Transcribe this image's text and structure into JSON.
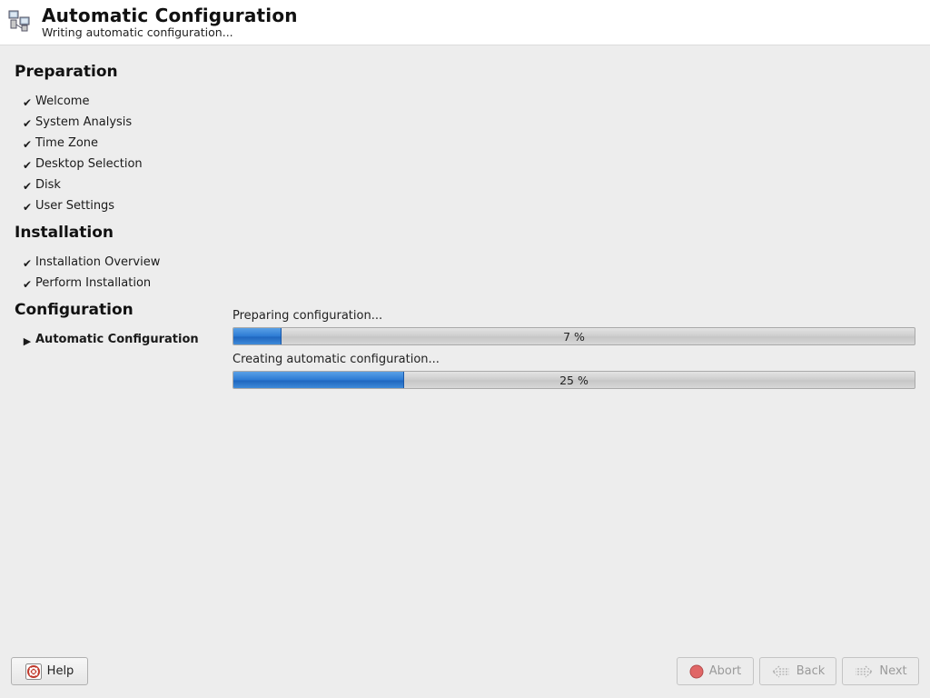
{
  "header": {
    "title": "Automatic Configuration",
    "subtitle": "Writing automatic configuration...",
    "icon": "network-config-icon"
  },
  "sidebar": {
    "sections": [
      {
        "title": "Preparation",
        "steps": [
          {
            "label": "Welcome",
            "status": "done"
          },
          {
            "label": "System Analysis",
            "status": "done"
          },
          {
            "label": "Time Zone",
            "status": "done"
          },
          {
            "label": "Desktop Selection",
            "status": "done"
          },
          {
            "label": "Disk",
            "status": "done"
          },
          {
            "label": "User Settings",
            "status": "done"
          }
        ]
      },
      {
        "title": "Installation",
        "steps": [
          {
            "label": "Installation Overview",
            "status": "done"
          },
          {
            "label": "Perform Installation",
            "status": "done"
          }
        ]
      },
      {
        "title": "Configuration",
        "steps": [
          {
            "label": "Automatic Configuration",
            "status": "current"
          }
        ]
      }
    ],
    "done_mark": "✔",
    "current_mark": "▶"
  },
  "progress": [
    {
      "label": "Preparing configuration...",
      "percent": 7,
      "text": "7 %"
    },
    {
      "label": "Creating automatic configuration...",
      "percent": 25,
      "text": "25 %"
    }
  ],
  "buttons": {
    "help": "Help",
    "abort": "Abort",
    "back": "Back",
    "next": "Next"
  },
  "colors": {
    "progress_fill": "#2d7bd4",
    "abort_icon": "#d9534f"
  }
}
